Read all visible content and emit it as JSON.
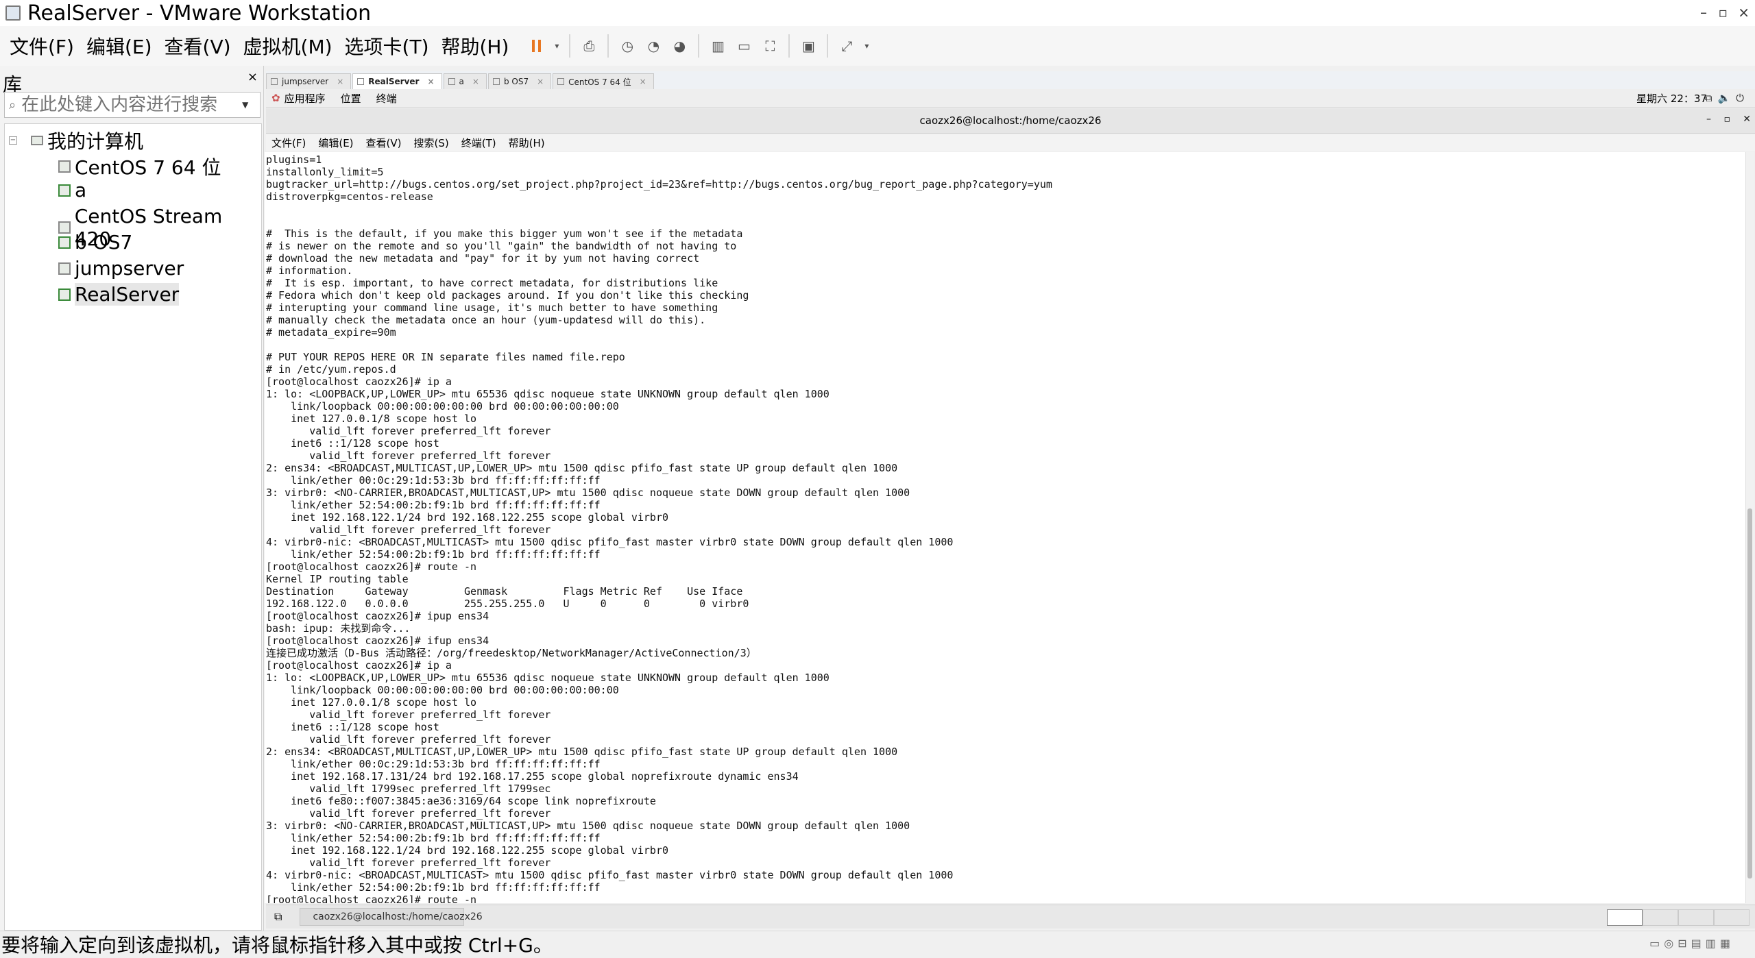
{
  "window": {
    "title": "RealServer - VMware Workstation",
    "controls": {
      "minimize": "–",
      "restore": "▫",
      "close": "×"
    }
  },
  "menubar": {
    "items": [
      "文件(F)",
      "编辑(E)",
      "查看(V)",
      "虚拟机(M)",
      "选项卡(T)",
      "帮助(H)"
    ]
  },
  "library": {
    "title": "库",
    "close": "×",
    "search_placeholder": "在此处键入内容进行搜索",
    "root": "我的计算机",
    "items": [
      {
        "label": "CentOS 7 64 位",
        "running": false
      },
      {
        "label": "a",
        "running": true
      },
      {
        "label": "CentOS Stream 420",
        "running": false
      },
      {
        "label": "b OS7",
        "running": true
      },
      {
        "label": "jumpserver",
        "running": false
      },
      {
        "label": "RealServer",
        "running": true,
        "selected": true
      }
    ]
  },
  "tabs": [
    {
      "label": "jumpserver",
      "active": false
    },
    {
      "label": "RealServer",
      "active": true
    },
    {
      "label": "a",
      "active": false
    },
    {
      "label": "b OS7",
      "active": false
    },
    {
      "label": "CentOS 7 64 位",
      "active": false
    }
  ],
  "gnome": {
    "apps": "应用程序",
    "places": "位置",
    "terminal": "终端",
    "clock": "星期六 22：37"
  },
  "terminal_window": {
    "title": "caozx26@localhost:/home/caozx26",
    "menu": [
      "文件(F)",
      "编辑(E)",
      "查看(V)",
      "搜索(S)",
      "终端(T)",
      "帮助(H)"
    ],
    "content": "plugins=1\ninstallonly_limit=5\nbugtracker_url=http://bugs.centos.org/set_project.php?project_id=23&ref=http://bugs.centos.org/bug_report_page.php?category=yum\ndistroverpkg=centos-release\n\n\n#  This is the default, if you make this bigger yum won't see if the metadata\n# is newer on the remote and so you'll \"gain\" the bandwidth of not having to\n# download the new metadata and \"pay\" for it by yum not having correct\n# information.\n#  It is esp. important, to have correct metadata, for distributions like\n# Fedora which don't keep old packages around. If you don't like this checking\n# interupting your command line usage, it's much better to have something\n# manually check the metadata once an hour (yum-updatesd will do this).\n# metadata_expire=90m\n\n# PUT YOUR REPOS HERE OR IN separate files named file.repo\n# in /etc/yum.repos.d\n[root@localhost caozx26]# ip a\n1: lo: <LOOPBACK,UP,LOWER_UP> mtu 65536 qdisc noqueue state UNKNOWN group default qlen 1000\n    link/loopback 00:00:00:00:00:00 brd 00:00:00:00:00:00\n    inet 127.0.0.1/8 scope host lo\n       valid_lft forever preferred_lft forever\n    inet6 ::1/128 scope host\n       valid_lft forever preferred_lft forever\n2: ens34: <BROADCAST,MULTICAST,UP,LOWER_UP> mtu 1500 qdisc pfifo_fast state UP group default qlen 1000\n    link/ether 00:0c:29:1d:53:3b brd ff:ff:ff:ff:ff:ff\n3: virbr0: <NO-CARRIER,BROADCAST,MULTICAST,UP> mtu 1500 qdisc noqueue state DOWN group default qlen 1000\n    link/ether 52:54:00:2b:f9:1b brd ff:ff:ff:ff:ff:ff\n    inet 192.168.122.1/24 brd 192.168.122.255 scope global virbr0\n       valid_lft forever preferred_lft forever\n4: virbr0-nic: <BROADCAST,MULTICAST> mtu 1500 qdisc pfifo_fast master virbr0 state DOWN group default qlen 1000\n    link/ether 52:54:00:2b:f9:1b brd ff:ff:ff:ff:ff:ff\n[root@localhost caozx26]# route -n\nKernel IP routing table\nDestination     Gateway         Genmask         Flags Metric Ref    Use Iface\n192.168.122.0   0.0.0.0         255.255.255.0   U     0      0        0 virbr0\n[root@localhost caozx26]# ipup ens34\nbash: ipup: 未找到命令...\n[root@localhost caozx26]# ifup ens34\n连接已成功激活（D-Bus 活动路径：/org/freedesktop/NetworkManager/ActiveConnection/3）\n[root@localhost caozx26]# ip a\n1: lo: <LOOPBACK,UP,LOWER_UP> mtu 65536 qdisc noqueue state UNKNOWN group default qlen 1000\n    link/loopback 00:00:00:00:00:00 brd 00:00:00:00:00:00\n    inet 127.0.0.1/8 scope host lo\n       valid_lft forever preferred_lft forever\n    inet6 ::1/128 scope host\n       valid_lft forever preferred_lft forever\n2: ens34: <BROADCAST,MULTICAST,UP,LOWER_UP> mtu 1500 qdisc pfifo_fast state UP group default qlen 1000\n    link/ether 00:0c:29:1d:53:3b brd ff:ff:ff:ff:ff:ff\n    inet 192.168.17.131/24 brd 192.168.17.255 scope global noprefixroute dynamic ens34\n       valid_lft 1799sec preferred_lft 1799sec\n    inet6 fe80::f007:3845:ae36:3169/64 scope link noprefixroute\n       valid_lft forever preferred_lft forever\n3: virbr0: <NO-CARRIER,BROADCAST,MULTICAST,UP> mtu 1500 qdisc noqueue state DOWN group default qlen 1000\n    link/ether 52:54:00:2b:f9:1b brd ff:ff:ff:ff:ff:ff\n    inet 192.168.122.1/24 brd 192.168.122.255 scope global virbr0\n       valid_lft forever preferred_lft forever\n4: virbr0-nic: <BROADCAST,MULTICAST> mtu 1500 qdisc pfifo_fast master virbr0 state DOWN group default qlen 1000\n    link/ether 52:54:00:2b:f9:1b brd ff:ff:ff:ff:ff:ff\n[root@localhost caozx26]# route -n"
  },
  "taskbar": {
    "item": "caozx26@localhost:/home/caozx26"
  },
  "status": {
    "text": "要将输入定向到该虚拟机，请将鼠标指针移入其中或按 Ctrl+G。"
  },
  "icons": {
    "app": "vmware-icon",
    "pause": "pause-icon",
    "search": "search-icon"
  },
  "colors": {
    "pause": "#e87722",
    "accent": "#3a8a3a"
  }
}
